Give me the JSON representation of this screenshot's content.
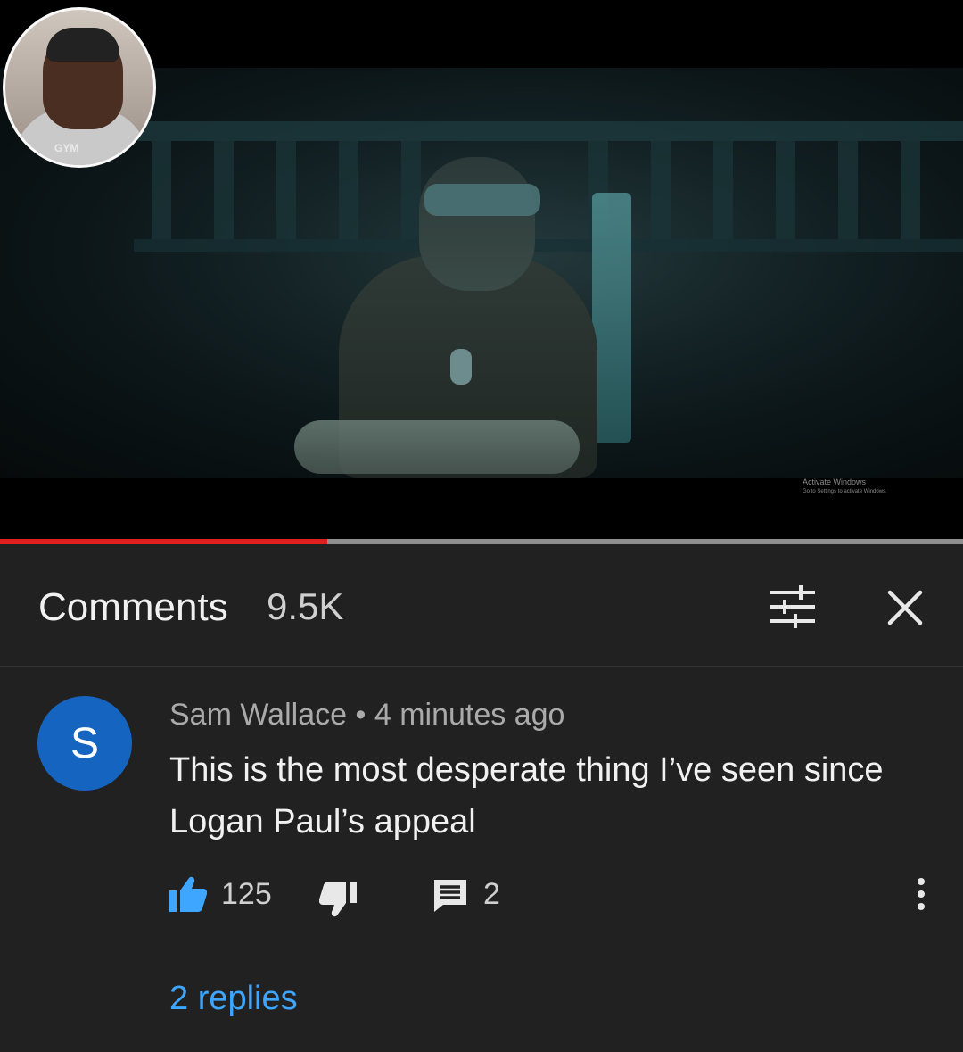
{
  "video": {
    "watermark_line1": "Activate Windows",
    "watermark_line2": "Go to Settings to activate Windows.",
    "bubble_shirt_text": "GYM",
    "progress_fraction": 0.34
  },
  "comments": {
    "title": "Comments",
    "count": "9.5K",
    "filter_icon": "filter-sliders-icon",
    "close_icon": "close-icon"
  },
  "comment": {
    "avatar_letter": "S",
    "author": "Sam Wallace",
    "separator": "•",
    "time": "4 minutes ago",
    "text": "This is the most desperate thing I’ve seen since Logan Paul’s appeal",
    "likes": "125",
    "reply_count": "2",
    "replies_link": "2 replies"
  },
  "colors": {
    "background": "#212121",
    "avatar": "#1565c0",
    "like_active": "#3ea6ff",
    "progress": "#e02020",
    "link": "#3ea6ff"
  }
}
